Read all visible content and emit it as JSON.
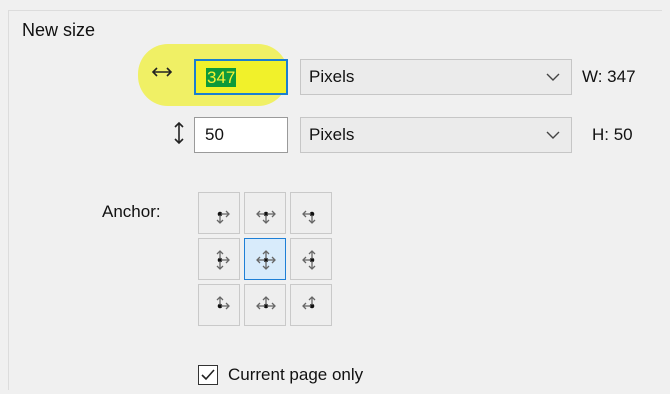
{
  "group": {
    "title": "New size"
  },
  "width": {
    "icon": "horizontal-resize-icon",
    "value": "347",
    "unit": "Pixels",
    "summary": "W: 347"
  },
  "height": {
    "icon": "vertical-resize-icon",
    "value": "50",
    "unit": "Pixels",
    "summary": "H: 50"
  },
  "anchor": {
    "label": "Anchor:",
    "selected": "middle-center",
    "cells": [
      "top-left",
      "top-center",
      "top-right",
      "middle-left",
      "middle-center",
      "middle-right",
      "bottom-left",
      "bottom-center",
      "bottom-right"
    ]
  },
  "current_page_only": {
    "label": "Current page only",
    "checked": true
  },
  "colors": {
    "highlight": "#f3f533",
    "focus_border": "#1a7fd0",
    "selection": "#0e9a3a",
    "anchor_selected_bg": "#d8ebfb"
  }
}
